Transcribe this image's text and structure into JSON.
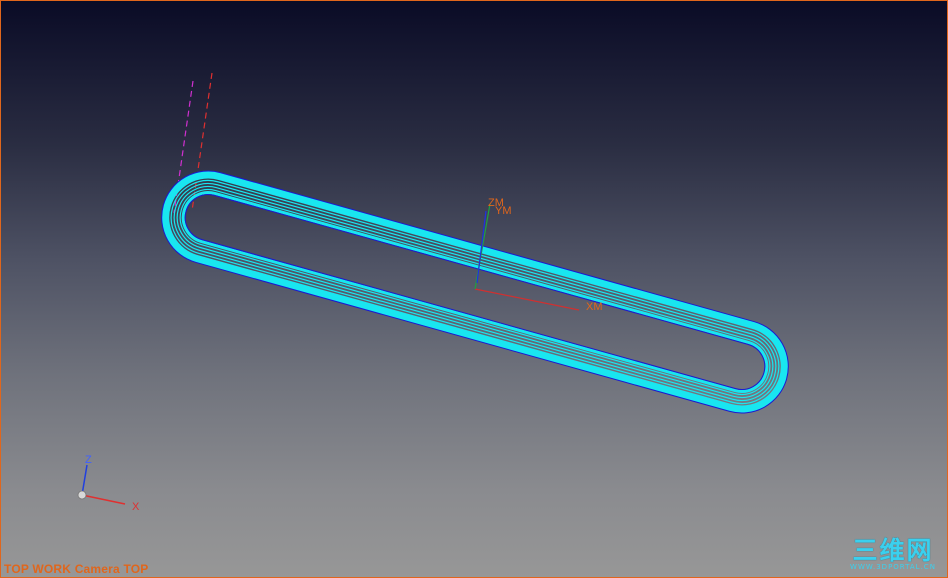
{
  "viewport": {
    "view_label": "TOP WORK Camera TOP",
    "background_top": "#0a0b26",
    "background_bottom": "#979797",
    "border_color": "#e0661c"
  },
  "part_csys": {
    "x_label": "XM",
    "y_label": "YM",
    "z_label": "ZM",
    "x_color": "#d03030",
    "y_color": "#20a040",
    "z_color": "#2030e0",
    "label_color": "#e0661c"
  },
  "triad": {
    "x_label": "X",
    "z_label": "Z",
    "x_color": "#e03030",
    "z_color": "#2040e0",
    "label_color_x": "#e03030",
    "label_color_z": "#4060ff"
  },
  "toolpath": {
    "shape": "obround slot",
    "color": "#19e6f0",
    "outline_color": "#1a1ad0"
  },
  "watermark": {
    "main": "三维网",
    "sub": "WWW.3DPORTAL.CN"
  }
}
